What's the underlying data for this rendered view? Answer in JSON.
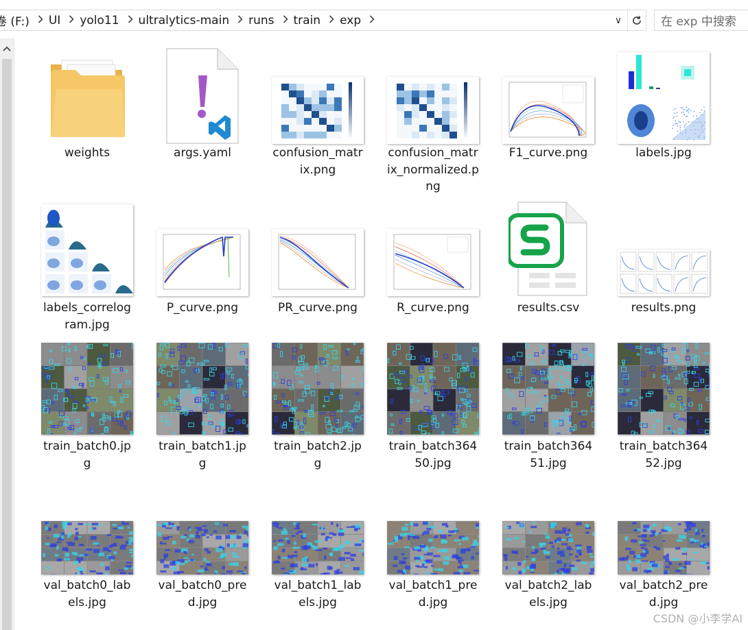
{
  "address": {
    "breadcrumbs": [
      "卷 (F:)",
      "UI",
      "yolo11",
      "ultralytics-main",
      "runs",
      "train",
      "exp"
    ],
    "dropdown_glyph": "∨",
    "search_placeholder": "在 exp 中搜索"
  },
  "icons": {
    "chevron": "chevron-right-icon",
    "dropdown": "chevron-down-icon",
    "refresh": "refresh-icon",
    "scroll_up": "scroll-up-icon"
  },
  "colors": {
    "folder": "#f5c767",
    "yaml_accent": "#a259c7",
    "vscode_blue": "#1f8ad2",
    "csv_green": "#16a34a",
    "heat_blue": "#2b63a6",
    "batch_cyan": "#3ad4e8"
  },
  "files": [
    {
      "name": "weights",
      "type": "folder"
    },
    {
      "name": "args.yaml",
      "type": "yaml"
    },
    {
      "name": "confusion_matrix.png",
      "type": "confusion"
    },
    {
      "name": "confusion_matrix_normalized.png",
      "type": "confusion"
    },
    {
      "name": "F1_curve.png",
      "type": "curve"
    },
    {
      "name": "labels.jpg",
      "type": "labels"
    },
    {
      "name": "labels_correlogram.jpg",
      "type": "correlogram"
    },
    {
      "name": "P_curve.png",
      "type": "curve"
    },
    {
      "name": "PR_curve.png",
      "type": "curve"
    },
    {
      "name": "R_curve.png",
      "type": "curve"
    },
    {
      "name": "results.csv",
      "type": "csv"
    },
    {
      "name": "results.png",
      "type": "results"
    },
    {
      "name": "train_batch0.jpg",
      "type": "batch"
    },
    {
      "name": "train_batch1.jpg",
      "type": "batch"
    },
    {
      "name": "train_batch2.jpg",
      "type": "batch"
    },
    {
      "name": "train_batch36450.jpg",
      "type": "batch"
    },
    {
      "name": "train_batch36451.jpg",
      "type": "batch"
    },
    {
      "name": "train_batch36452.jpg",
      "type": "batch"
    },
    {
      "name": "val_batch0_labels.jpg",
      "type": "valbatch"
    },
    {
      "name": "val_batch0_pred.jpg",
      "type": "valbatch"
    },
    {
      "name": "val_batch1_labels.jpg",
      "type": "valbatch"
    },
    {
      "name": "val_batch1_pred.jpg",
      "type": "valbatch"
    },
    {
      "name": "val_batch2_labels.jpg",
      "type": "valbatch"
    },
    {
      "name": "val_batch2_pred.jpg",
      "type": "valbatch"
    }
  ],
  "watermark": "CSDN @小李学AI"
}
